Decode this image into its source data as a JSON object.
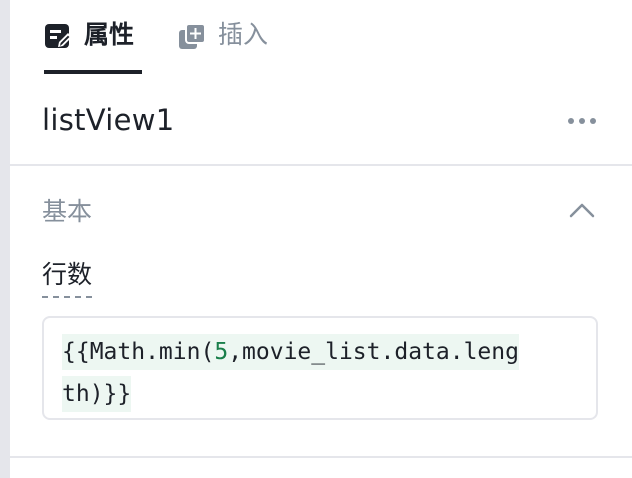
{
  "tabs": [
    {
      "label": "属性",
      "icon": "edit-form-icon",
      "active": true
    },
    {
      "label": "插入",
      "icon": "add-copy-icon",
      "active": false
    }
  ],
  "component": {
    "name": "listView1",
    "more_icon": "more-horizontal-icon"
  },
  "section": {
    "title": "基本",
    "collapse_icon": "chevron-up-icon",
    "fields": [
      {
        "label": "行数",
        "value": "{{Math.min(5,movie_list.data.length)}}",
        "display_lines": [
          {
            "before": "{{Math.min(",
            "number": "5",
            "after": ",movie_list.data.leng"
          },
          {
            "text": "th)}}"
          }
        ]
      }
    ]
  },
  "colors": {
    "text_primary": "#1d2129",
    "text_secondary": "#86909c",
    "divider": "#e5e6eb",
    "code_highlight": "#edf7f2",
    "code_number": "#1a7f4b"
  }
}
